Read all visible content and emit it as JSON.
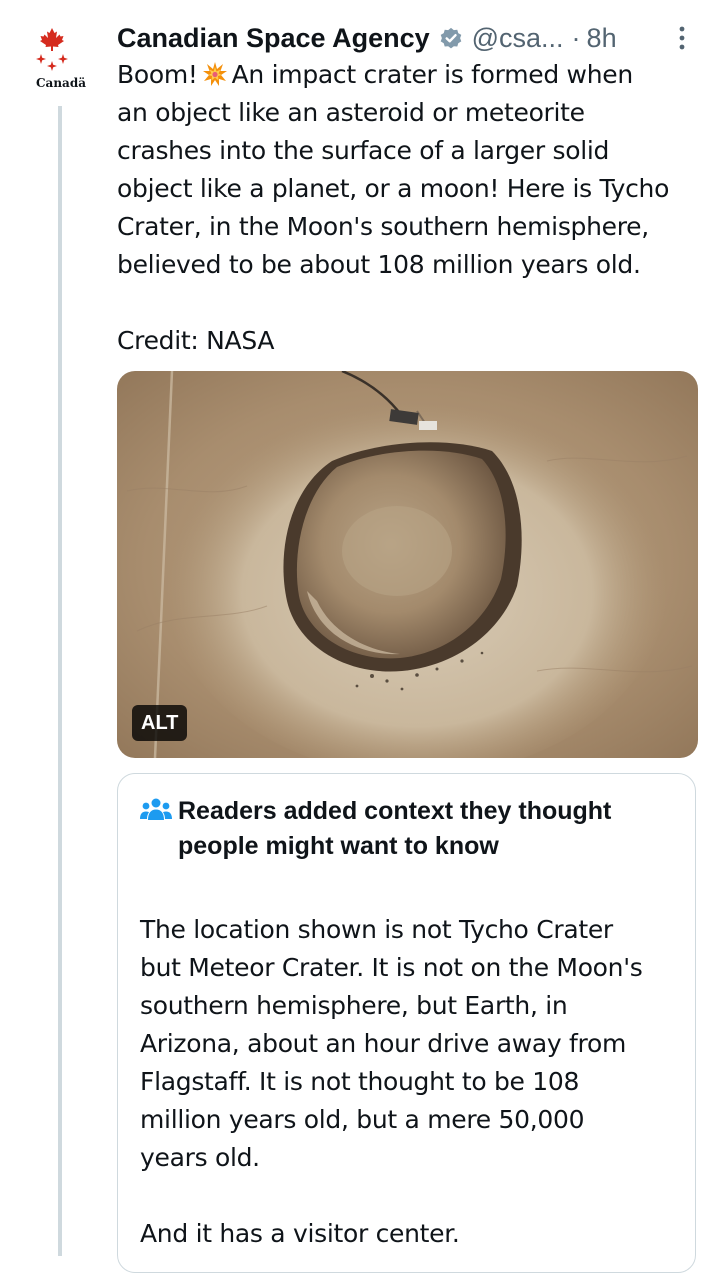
{
  "account": {
    "display_name": "Canadian Space Agency",
    "handle": "@csa...",
    "separator": "·",
    "time": "8h",
    "avatar_wordmark": "Canadä"
  },
  "tweet": {
    "text_lines": [
      "Boom!",
      "An impact crater is formed when",
      "an object like an asteroid or meteorite",
      "crashes into the surface of a larger solid",
      "object like a planet, or a moon! Here is Tycho",
      "Crater, in the Moon's southern hemisphere,",
      "believed to be about 108 million years old."
    ],
    "credit": "Credit: NASA"
  },
  "media": {
    "alt_label": "ALT"
  },
  "community_note": {
    "title_lines": [
      "Readers added context they thought",
      "people might want to know"
    ],
    "body_paragraph_1": [
      "The location shown is not Tycho Crater",
      "but Meteor Crater. It is not on the Moon's",
      "southern hemisphere, but Earth, in",
      "Arizona, about an hour drive away from",
      "Flagstaff. It is not thought to be 108",
      "million years old, but a mere 50,000",
      "years old."
    ],
    "body_paragraph_2": [
      "And it has a visitor center."
    ]
  },
  "icons": {
    "avatar": "canada-maple-leaf-icon",
    "verified": "verified-badge-icon",
    "more": "more-options-icon",
    "boom": "collision-emoji-icon",
    "note": "community-notes-people-icon"
  },
  "colors": {
    "text": "#0f1419",
    "secondary": "#536471",
    "verified_badge": "#829aab",
    "canada_red": "#d52b1e",
    "note_icon": "#1d9bf0",
    "border": "#cfd9de"
  }
}
